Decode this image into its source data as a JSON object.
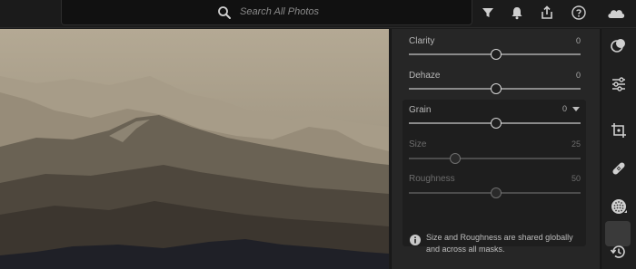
{
  "search": {
    "placeholder": "Search All Photos"
  },
  "topbar": {
    "icons": [
      "filter-icon",
      "bell-icon",
      "share-icon",
      "help-icon",
      "cloud-icon"
    ]
  },
  "panel": {
    "clarity": {
      "label": "Clarity",
      "value": "0"
    },
    "dehaze": {
      "label": "Dehaze",
      "value": "0"
    },
    "grain": {
      "label": "Grain",
      "value": "0"
    },
    "size": {
      "label": "Size",
      "value": "25"
    },
    "roughness": {
      "label": "Roughness",
      "value": "50"
    },
    "info": "Size and Roughness are shared globally and across all masks."
  },
  "toolstrip": {
    "icons": [
      "mask-icon",
      "adjust-sliders-icon",
      "crop-icon",
      "healing-icon",
      "grain-effects-icon",
      "history-icon"
    ],
    "active": "grain-effects-icon"
  },
  "colors": {
    "panel_bg": "#262626",
    "grain_box_bg": "#1e1e1e",
    "photo_tone": "#8a7e6c"
  }
}
